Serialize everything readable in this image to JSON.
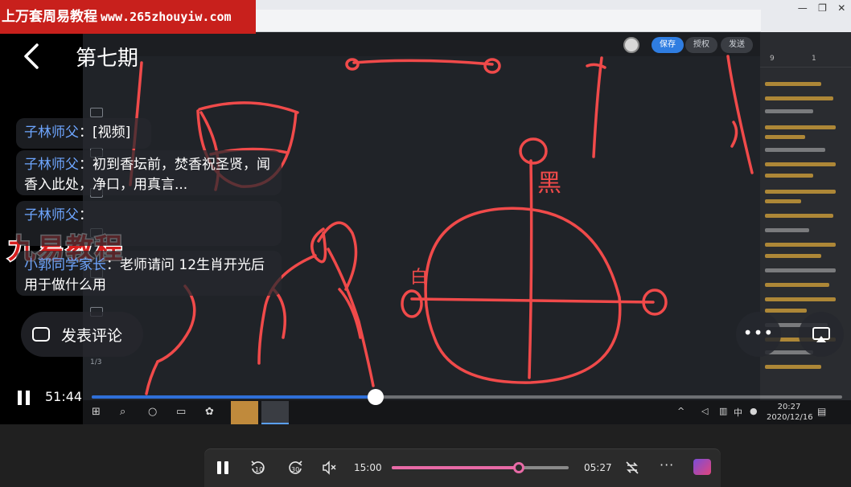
{
  "watermark": {
    "top_text": "上万套周易教程",
    "url": "www.265zhouyiw.com",
    "middle_text": "九易教程"
  },
  "header": {
    "title": "第七期"
  },
  "comments": [
    {
      "name": "子林师父",
      "sep": "：",
      "text": "[视频]"
    },
    {
      "name": "子林师父",
      "sep": "：",
      "text": "初到香坛前，焚香祝圣贤，闻香入此处，净口，用真言..."
    },
    {
      "name": "子林师父",
      "sep": "：",
      "text": ""
    },
    {
      "name": "小郭同学家长",
      "sep": "：",
      "text": "老师请问 12生肖开光后用于做什么用"
    }
  ],
  "comment_button": {
    "label": "发表评论"
  },
  "more_button": {
    "label": "•••"
  },
  "video_player": {
    "elapsed": "51:44",
    "progress": 0.378
  },
  "recording": {
    "buttons": {
      "save": "保存",
      "permission": "授权",
      "send": "发送"
    },
    "board_labels": {
      "top": "黑",
      "left": "白"
    },
    "page_indicator": "1/3",
    "clock": {
      "time": "20:27",
      "date": "2020/12/16"
    },
    "ime": "中",
    "panel_tabs": [
      "9",
      "1"
    ]
  },
  "media_bar": {
    "current_time": "15:00",
    "duration": "05:27",
    "progress": 0.72,
    "rewind_label": "10",
    "forward_label": "30"
  },
  "colors": {
    "accent_blue": "#2f6fd8",
    "media_pink": "#e86aa6",
    "ink_red": "#f04a4a",
    "watermark_red": "#c8201c"
  }
}
